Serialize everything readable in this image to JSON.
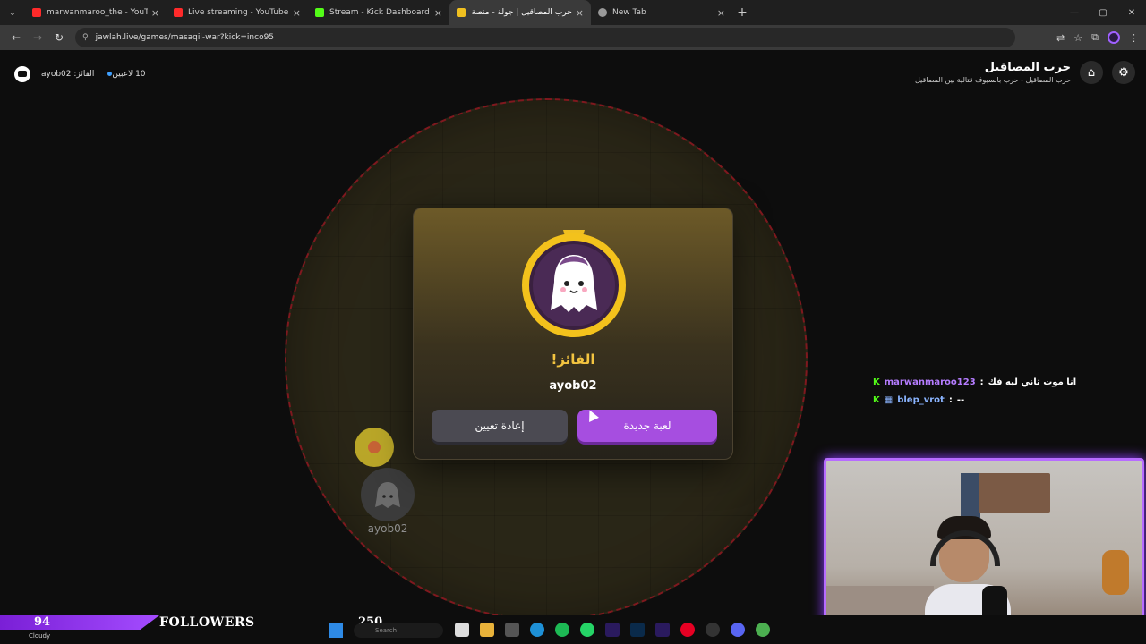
{
  "browser": {
    "tabs": [
      {
        "title": "marwanmaroo_the - YouTube",
        "color": "#ff2a2a",
        "active": false
      },
      {
        "title": "Live streaming - YouTube Studio",
        "color": "#ff2a2a",
        "active": false
      },
      {
        "title": "Stream - Kick Dashboard",
        "color": "#53fc18",
        "active": false
      },
      {
        "title": "حرب المصاقيل | جولة - منصة الألعاب الت",
        "color": "#f0c020",
        "active": true
      },
      {
        "title": "New Tab",
        "color": "#999999",
        "active": false
      }
    ],
    "url": "jawlah.live/games/masaqil-war?kick=inco95"
  },
  "game": {
    "title": "حرب المصاقيل",
    "subtitle": "حرب المصاقيل - حرب بالسيوف قتالية بين المصاقيل",
    "winner_status": "الفائز: ayob02",
    "players_count": "10 لاعبين",
    "modal": {
      "title": "الفائز!",
      "winner": "ayob02",
      "reset_label": "إعادة تعيين",
      "new_game_label": "لعبة جديدة"
    },
    "player_label": "ayob02"
  },
  "chat": [
    {
      "user": "marwanmaroo123",
      "message": "انا موت تاني ليه فك",
      "color": "#b57cff"
    },
    {
      "user": "blep_vrot",
      "message": "--",
      "color": "#8ab4ff"
    }
  ],
  "overlay": {
    "followers_count": "94",
    "followers_label": "FOLLOWERS",
    "goal": "250",
    "weather": "Cloudy"
  },
  "taskbar": {
    "search_placeholder": "Search"
  }
}
